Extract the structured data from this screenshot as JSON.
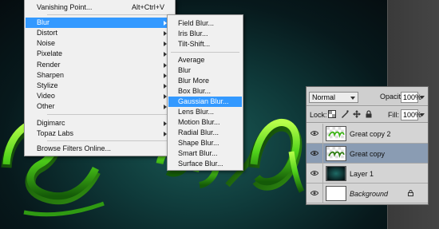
{
  "filter_menu": {
    "items": [
      {
        "label": "Vanishing Point...",
        "shortcut": "Alt+Ctrl+V",
        "submenu": false
      },
      {
        "label": "Blur",
        "shortcut": "",
        "submenu": true,
        "highlighted": true
      },
      {
        "label": "Distort",
        "shortcut": "",
        "submenu": true
      },
      {
        "label": "Noise",
        "shortcut": "",
        "submenu": true
      },
      {
        "label": "Pixelate",
        "shortcut": "",
        "submenu": true
      },
      {
        "label": "Render",
        "shortcut": "",
        "submenu": true
      },
      {
        "label": "Sharpen",
        "shortcut": "",
        "submenu": true
      },
      {
        "label": "Stylize",
        "shortcut": "",
        "submenu": true
      },
      {
        "label": "Video",
        "shortcut": "",
        "submenu": true
      },
      {
        "label": "Other",
        "shortcut": "",
        "submenu": true
      },
      {
        "label": "Digimarc",
        "shortcut": "",
        "submenu": true
      },
      {
        "label": "Topaz Labs",
        "shortcut": "",
        "submenu": true
      },
      {
        "label": "Browse Filters Online...",
        "shortcut": "",
        "submenu": false
      }
    ]
  },
  "blur_submenu": {
    "items": [
      {
        "label": "Field Blur..."
      },
      {
        "label": "Iris Blur..."
      },
      {
        "label": "Tilt-Shift..."
      },
      {
        "label": "Average"
      },
      {
        "label": "Blur"
      },
      {
        "label": "Blur More"
      },
      {
        "label": "Box Blur..."
      },
      {
        "label": "Gaussian Blur...",
        "highlighted": true
      },
      {
        "label": "Lens Blur..."
      },
      {
        "label": "Motion Blur..."
      },
      {
        "label": "Radial Blur..."
      },
      {
        "label": "Shape Blur..."
      },
      {
        "label": "Smart Blur..."
      },
      {
        "label": "Surface Blur..."
      }
    ]
  },
  "layers_panel": {
    "blend_mode": "Normal",
    "opacity_label": "Opacity:",
    "opacity_value": "100%",
    "lock_label": "Lock:",
    "fill_label": "Fill:",
    "fill_value": "100%",
    "layers": [
      {
        "name": "Great copy 2",
        "selected": false,
        "italic": false
      },
      {
        "name": "Great copy",
        "selected": true,
        "italic": false
      },
      {
        "name": "Layer 1",
        "selected": false,
        "italic": false
      },
      {
        "name": "Background",
        "selected": false,
        "italic": true,
        "locked": true
      }
    ]
  },
  "colors": {
    "menu_highlight": "#3399ff",
    "layer_selected": "#8a9cb3",
    "text_green": "#4fd11a"
  }
}
